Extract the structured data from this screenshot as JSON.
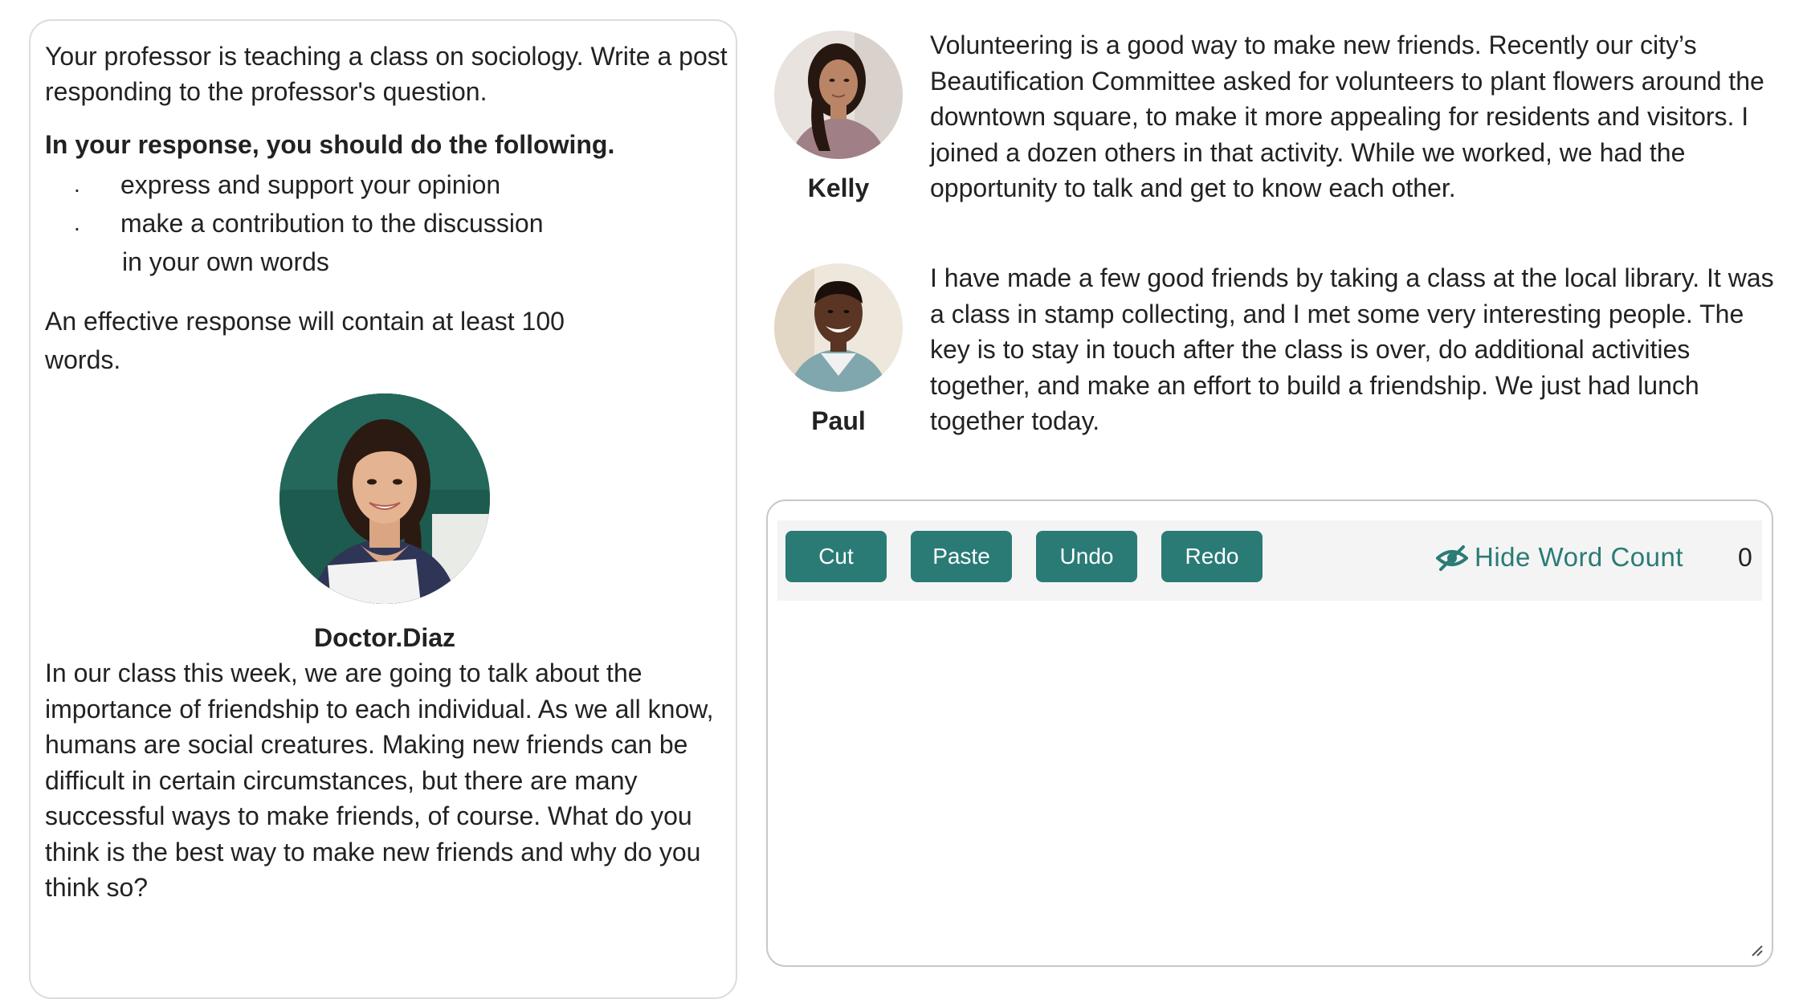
{
  "prompt": {
    "intro": "Your professor is teaching a class on sociology. Write a post responding to the professor's question.",
    "instructions_heading": "In your response, you should do the following.",
    "instructions": [
      "express and support your opinion",
      "make a contribution to the discussion"
    ],
    "instructions_extra": "in your own words",
    "length_note": "An effective response will contain at least 100 words.",
    "bullet_char": "."
  },
  "professor": {
    "name": "Doctor.Diaz",
    "avatar_icon": "professor-avatar-photo",
    "question": "In our class this week, we are going to talk about the importance of friendship to each individual. As we all know, humans are social creatures. Making new friends can be difficult in certain circumstances, but there are many successful ways to make friends, of course. What do you think is the best way to make new friends and why do you think so?"
  },
  "students": [
    {
      "name": "Kelly",
      "avatar_icon": "kelly-avatar-photo",
      "post": "Volunteering is a good way to make new friends. Recently our city’s Beautification Committee asked for volunteers to plant flowers around the downtown square, to make it more appealing for residents and visitors. I joined a dozen others in that activity. While we worked, we had the opportunity to talk and get to know each other."
    },
    {
      "name": "Paul",
      "avatar_icon": "paul-avatar-photo",
      "post": "I have made a few good friends by taking a class at the local library. It was a class in stamp collecting, and I met some very interesting people. The key is to stay in touch after the class is over, do additional activities together, and make an effort to build a friendship. We just had lunch together today."
    }
  ],
  "editor": {
    "buttons": {
      "cut": "Cut",
      "paste": "Paste",
      "undo": "Undo",
      "redo": "Redo"
    },
    "word_count_toggle": "Hide Word Count",
    "word_count_icon": "eye-slash-icon",
    "word_count": "0",
    "answer_text": ""
  },
  "colors": {
    "accent": "#2a7b76",
    "toolbar_bg": "#f4f4f4",
    "panel_border": "#dcdcdc"
  }
}
